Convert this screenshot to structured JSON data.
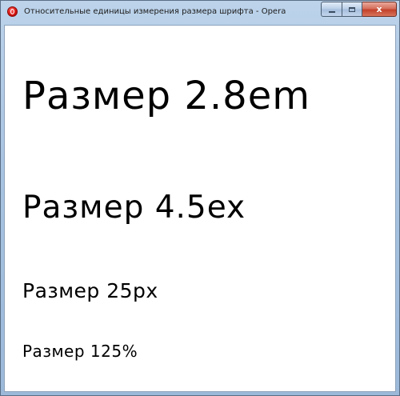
{
  "window": {
    "title": "Относительные единицы измерения размера шрифта - Opera",
    "app_icon": "opera-icon",
    "controls": {
      "minimize": "minimize-icon",
      "maximize": "maximize-icon",
      "close_label": "x"
    }
  },
  "content": {
    "lines": [
      {
        "text": "Размер 2.8em"
      },
      {
        "text": "Размер 4.5ex"
      },
      {
        "text": "Размер 25px"
      },
      {
        "text": "Размер 125%"
      }
    ]
  }
}
